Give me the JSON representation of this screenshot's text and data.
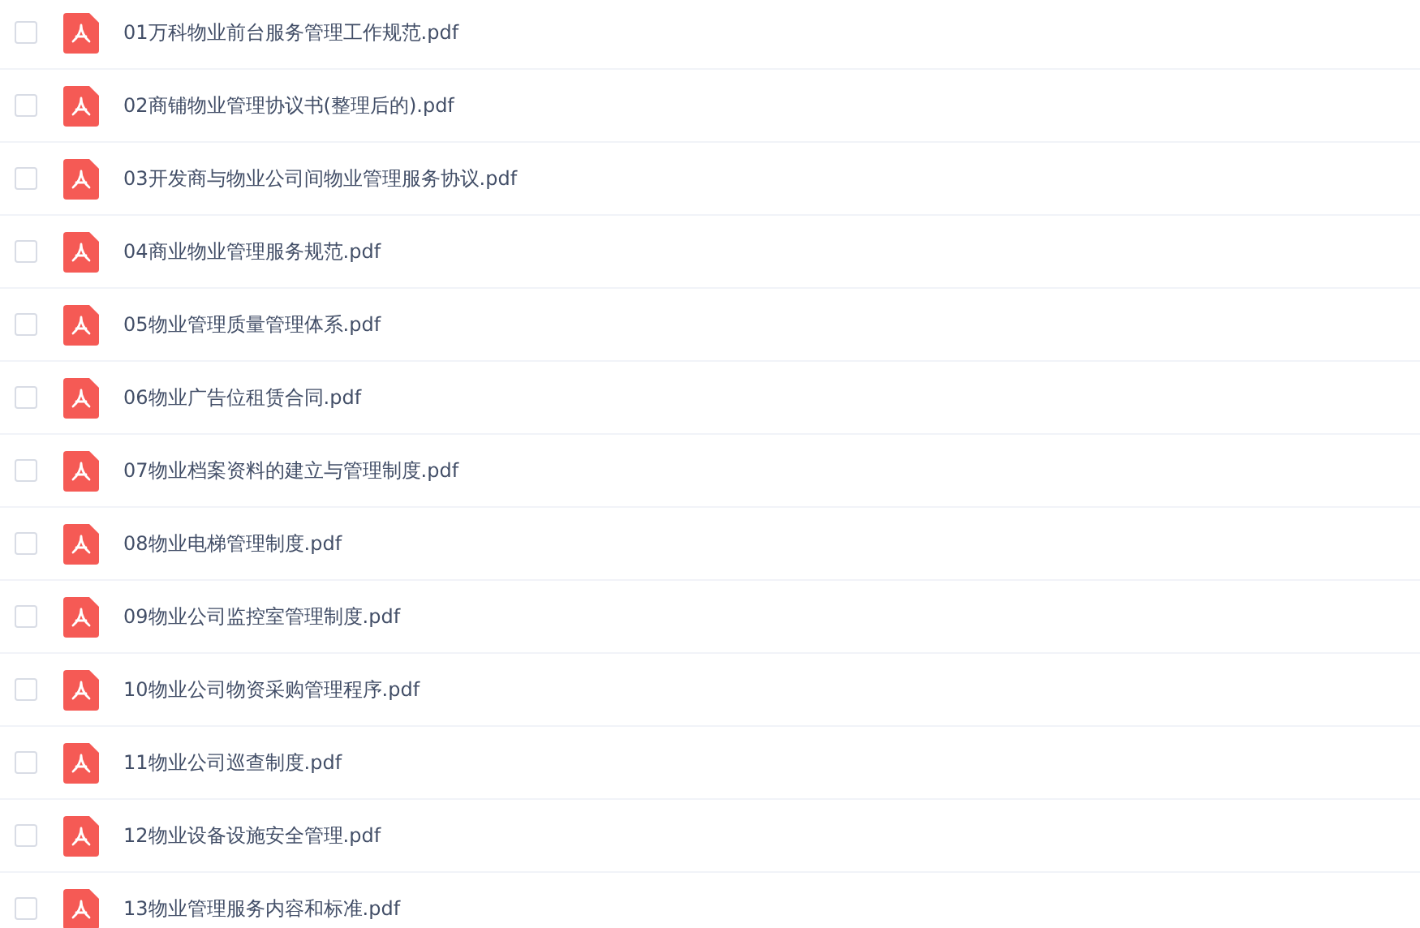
{
  "files": [
    {
      "name": "01万科物业前台服务管理工作规范.pdf",
      "checked": false
    },
    {
      "name": "02商铺物业管理协议书(整理后的).pdf",
      "checked": false
    },
    {
      "name": "03开发商与物业公司间物业管理服务协议.pdf",
      "checked": false
    },
    {
      "name": "04商业物业管理服务规范.pdf",
      "checked": false
    },
    {
      "name": "05物业管理质量管理体系.pdf",
      "checked": false
    },
    {
      "name": "06物业广告位租赁合同.pdf",
      "checked": false
    },
    {
      "name": "07物业档案资料的建立与管理制度.pdf",
      "checked": false
    },
    {
      "name": "08物业电梯管理制度.pdf",
      "checked": false
    },
    {
      "name": "09物业公司监控室管理制度.pdf",
      "checked": false
    },
    {
      "name": "10物业公司物资采购管理程序.pdf",
      "checked": false
    },
    {
      "name": "11物业公司巡查制度.pdf",
      "checked": false
    },
    {
      "name": "12物业设备设施安全管理.pdf",
      "checked": false
    },
    {
      "name": "13物业管理服务内容和标准.pdf",
      "checked": false
    }
  ]
}
